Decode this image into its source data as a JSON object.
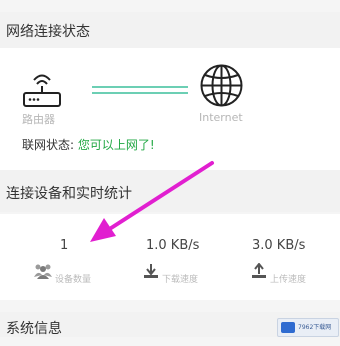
{
  "network": {
    "title": "网络连接状态",
    "router_label": "路由器",
    "internet_label": "Internet",
    "status_prefix": "联网状态: ",
    "status_value": "您可以上网了!",
    "colors": {
      "line": "#3bbf9c",
      "ok": "#22a844"
    }
  },
  "devices": {
    "title": "连接设备和实时统计",
    "stats": [
      {
        "value": "1",
        "label": "设备数量",
        "icon": "users-icon"
      },
      {
        "value": "1.0 KB/s",
        "label": "下载速度",
        "icon": "download-icon"
      },
      {
        "value": "3.0 KB/s",
        "label": "上传速度",
        "icon": "upload-icon"
      }
    ]
  },
  "system": {
    "title": "系统信息"
  },
  "annotation": {
    "color": "#e11fd0"
  },
  "watermark": {
    "text": "7962下载网"
  }
}
